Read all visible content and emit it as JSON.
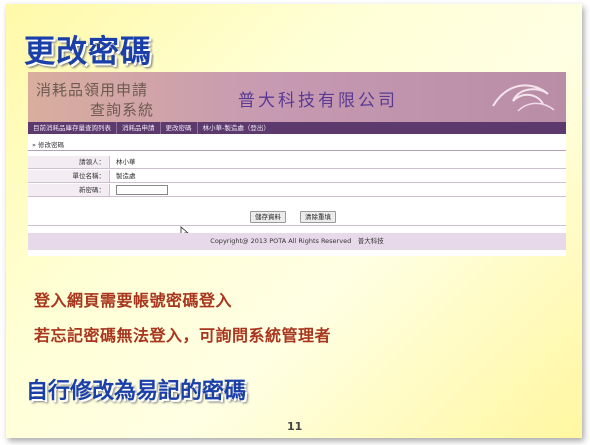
{
  "slide": {
    "title": "更改密碼",
    "bullets": [
      "登入網頁需要帳號密碼登入",
      "若忘記密碼無法登入，可詢問系統管理者"
    ],
    "headline": "自行修改為易記的密碼",
    "page_number": "11"
  },
  "web": {
    "system_name_line1": "消耗品領用申請",
    "system_name_line2": "查詢系統",
    "company_name": "普大科技有限公司",
    "nav": [
      "目前消耗品庫存量查詢列表",
      "消耗品申請",
      "更改密碼",
      "林小華-製造處（登出）"
    ],
    "breadcrumb": "» 修改密碼",
    "form": {
      "applicant_label": "請領人：",
      "applicant_value": "林小華",
      "unit_label": "單位名稱：",
      "unit_value": "製造處",
      "new_password_label": "新密碼：",
      "new_password_value": ""
    },
    "buttons": {
      "save": "儲存資料",
      "clear": "清除重填"
    },
    "footer": "Copyright@ 2013 POTA All Rights Reserved　普大科技"
  },
  "colors": {
    "title_blue": "#1a3fa8",
    "bullet_red": "#a8361e",
    "nav_purple": "#5c3a6e"
  }
}
